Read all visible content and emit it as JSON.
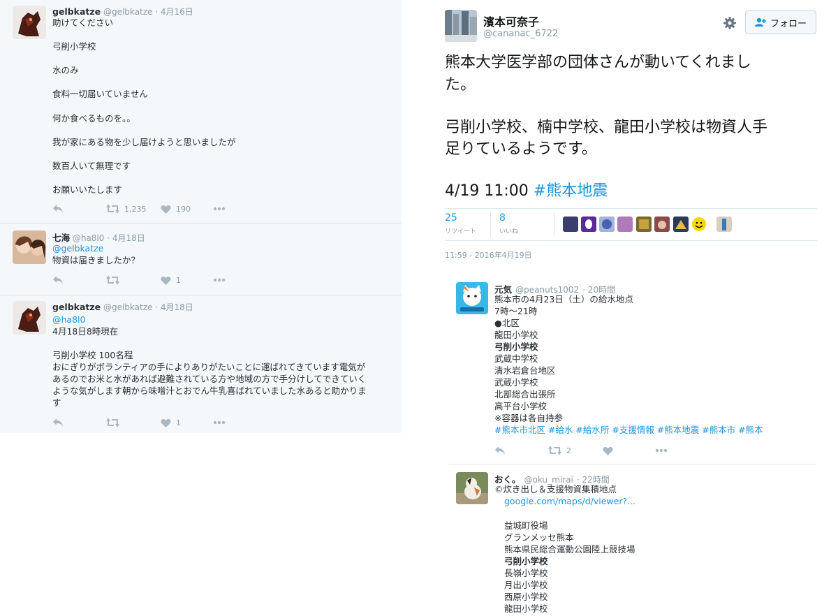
{
  "left": {
    "tweet1": {
      "name": "gelbkatze",
      "handle": "@gelbkatze",
      "date": "· 4月16日",
      "lines": [
        "助けてください",
        "弓削小学校",
        "水のみ",
        "食料一切届いていません",
        "何か食べるものを。。",
        "我が家にある物を少し届けようと思いましたが",
        "数百人いて無理です",
        "お願いいたします"
      ],
      "retweets": "1,235",
      "likes": "190"
    },
    "tweet2": {
      "name": "七海",
      "handle": "@ha8l0",
      "date": "· 4月18日",
      "mention": "@gelbkatze",
      "text": "物資は届きましたか？",
      "likes": "1"
    },
    "tweet3": {
      "name": "gelbkatze",
      "handle": "@gelbkatze",
      "date": "· 4月18日",
      "mention": "@ha8l0",
      "line1": "4月18日8時現在",
      "line2": "弓削小学校 100名程",
      "body": [
        "おにぎりがボランティアの手によりありがたいことに運ばれてきています電気が",
        "あるのでお米と水があれば避難されている方や地域の方で手分けしてできていく",
        "ような気がします朝から味噌汁とおでん牛乳喜ばれていました水あると助かりま",
        "す"
      ],
      "likes": "1"
    }
  },
  "right": {
    "user": {
      "name": "濱本可奈子",
      "handle": "@cananac_6722"
    },
    "follow_label": "フォロー",
    "tweet_lines": [
      "熊本大学医学部の団体さんが動いてくれまし",
      "た。",
      "弓削小学校、楠中学校、龍田小学校は物資人手",
      "足りているようです。"
    ],
    "time_text": "4/19 11:00 ",
    "hashtag": "#熊本地震",
    "stats": {
      "retweets": "25",
      "retweets_label": "リツイート",
      "likes": "8",
      "likes_label": "いいね"
    },
    "timestamp": "11:59 - 2016年4月19日",
    "reply1": {
      "name": "元気",
      "handle": "@peanuts1002",
      "time": "· 20時間",
      "lines": [
        "熊本市の4月23日（土）の給水地点",
        "7時～21時",
        "●北区",
        "龍田小学校",
        "弓削小学校",
        "武蔵中学校",
        "清水岩倉台地区",
        "武蔵小学校",
        "北部総合出張所",
        "高平台小学校",
        "※容器は各自持参"
      ],
      "hashtags": "#熊本市北区 #給水 #給水所 #支援情報 #熊本地震 #熊本市 #熊本",
      "retweets": "2"
    },
    "reply2": {
      "name": "おく。",
      "handle": "@oku_mirai",
      "time": "· 22時間",
      "line0": "©炊き出し＆支援物資集積地点",
      "link": "google.com/maps/d/viewer?...",
      "lines": [
        "益城町役場",
        "グランメッセ熊本",
        "熊本県民総合運動公園陸上競技場",
        "弓削小学校",
        "長嶺小学校",
        "月出小学校",
        "西原小学校",
        "龍田小学校"
      ]
    }
  }
}
